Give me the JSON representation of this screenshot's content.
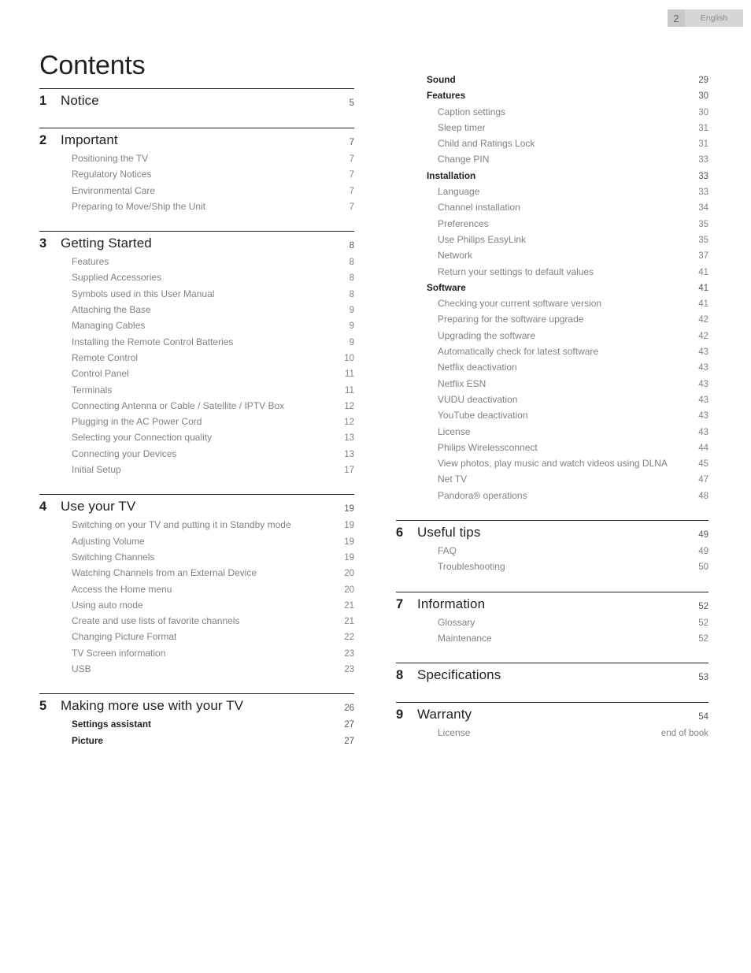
{
  "header": {
    "page_number": "2",
    "language": "English"
  },
  "title": "Contents",
  "columns": {
    "left": [
      {
        "number": "1",
        "title": "Notice",
        "page": "5",
        "entries": []
      },
      {
        "number": "2",
        "title": "Important",
        "page": "7",
        "entries": [
          {
            "level": 3,
            "label": "Positioning the TV",
            "page": "7"
          },
          {
            "level": 3,
            "label": "Regulatory Notices",
            "page": "7"
          },
          {
            "level": 3,
            "label": "Environmental Care",
            "page": "7"
          },
          {
            "level": 3,
            "label": "Preparing to Move/Ship the Unit",
            "page": "7"
          }
        ]
      },
      {
        "number": "3",
        "title": "Getting Started",
        "page": "8",
        "entries": [
          {
            "level": 3,
            "label": "Features",
            "page": "8"
          },
          {
            "level": 3,
            "label": "Supplied Accessories",
            "page": "8"
          },
          {
            "level": 3,
            "label": "Symbols used in this User Manual",
            "page": "8"
          },
          {
            "level": 3,
            "label": "Attaching the Base",
            "page": "9"
          },
          {
            "level": 3,
            "label": "Managing Cables",
            "page": "9"
          },
          {
            "level": 3,
            "label": "Installing the Remote Control Batteries",
            "page": "9"
          },
          {
            "level": 3,
            "label": "Remote Control",
            "page": "10"
          },
          {
            "level": 3,
            "label": "Control Panel",
            "page": "11"
          },
          {
            "level": 3,
            "label": "Terminals",
            "page": "11"
          },
          {
            "level": 3,
            "label": "Connecting Antenna or Cable / Satellite / IPTV Box",
            "page": "12"
          },
          {
            "level": 3,
            "label": "Plugging in the AC Power Cord",
            "page": "12"
          },
          {
            "level": 3,
            "label": "Selecting your Connection quality",
            "page": "13"
          },
          {
            "level": 3,
            "label": "Connecting your Devices",
            "page": "13"
          },
          {
            "level": 3,
            "label": "Initial Setup",
            "page": "17"
          }
        ]
      },
      {
        "number": "4",
        "title": "Use your TV",
        "page": "19",
        "entries": [
          {
            "level": 3,
            "label": "Switching on your TV and putting it in Standby mode",
            "page": "19"
          },
          {
            "level": 3,
            "label": "Adjusting Volume",
            "page": "19"
          },
          {
            "level": 3,
            "label": "Switching Channels",
            "page": "19"
          },
          {
            "level": 3,
            "label": "Watching Channels from an External Device",
            "page": "20"
          },
          {
            "level": 3,
            "label": "Access the Home menu",
            "page": "20"
          },
          {
            "level": 3,
            "label": "Using auto mode",
            "page": "21"
          },
          {
            "level": 3,
            "label": "Create and use lists of favorite channels",
            "page": "21"
          },
          {
            "level": 3,
            "label": "Changing Picture Format",
            "page": "22"
          },
          {
            "level": 3,
            "label": "TV Screen information",
            "page": "23"
          },
          {
            "level": 3,
            "label": "USB",
            "page": "23"
          }
        ]
      },
      {
        "number": "5",
        "title": "Making more use with your TV",
        "page": "26",
        "entries": [
          {
            "level": 2,
            "label": "Settings assistant",
            "page": "27"
          },
          {
            "level": 2,
            "label": "Picture",
            "page": "27"
          }
        ]
      }
    ],
    "right": [
      {
        "number": "",
        "title": "",
        "page": "",
        "entries": [
          {
            "level": 2,
            "label": "Sound",
            "page": "29"
          },
          {
            "level": 2,
            "label": "Features",
            "page": "30"
          },
          {
            "level": 3,
            "label": "Caption settings",
            "page": "30"
          },
          {
            "level": 3,
            "label": "Sleep timer",
            "page": "31"
          },
          {
            "level": 3,
            "label": "Child and Ratings Lock",
            "page": "31"
          },
          {
            "level": 3,
            "label": "Change PIN",
            "page": "33"
          },
          {
            "level": 2,
            "label": "Installation",
            "page": "33"
          },
          {
            "level": 3,
            "label": "Language",
            "page": "33"
          },
          {
            "level": 3,
            "label": "Channel installation",
            "page": "34"
          },
          {
            "level": 3,
            "label": "Preferences",
            "page": "35"
          },
          {
            "level": 3,
            "label": "Use Philips EasyLink",
            "page": "35"
          },
          {
            "level": 3,
            "label": "Network",
            "page": "37"
          },
          {
            "level": 3,
            "label": "Return your settings to default values",
            "page": "41"
          },
          {
            "level": 2,
            "label": "Software",
            "page": "41"
          },
          {
            "level": 3,
            "label": "Checking your current software version",
            "page": "41"
          },
          {
            "level": 3,
            "label": "Preparing for the software upgrade",
            "page": "42"
          },
          {
            "level": 3,
            "label": "Upgrading the software",
            "page": "42"
          },
          {
            "level": 3,
            "label": "Automatically check for latest software",
            "page": "43"
          },
          {
            "level": 3,
            "label": "Netflix deactivation",
            "page": "43"
          },
          {
            "level": 3,
            "label": "Netflix ESN",
            "page": "43"
          },
          {
            "level": 3,
            "label": "VUDU deactivation",
            "page": "43"
          },
          {
            "level": 3,
            "label": "YouTube deactivation",
            "page": "43"
          },
          {
            "level": 3,
            "label": "License",
            "page": "43"
          },
          {
            "level": 3,
            "label": "Philips Wirelessconnect",
            "page": "44"
          },
          {
            "level": 3,
            "label": "View photos, play music and watch videos using DLNA",
            "page": "45"
          },
          {
            "level": 3,
            "label": "Net TV",
            "page": "47"
          },
          {
            "level": 3,
            "label": "Pandora® operations",
            "page": "48"
          }
        ]
      },
      {
        "number": "6",
        "title": "Useful tips",
        "page": "49",
        "entries": [
          {
            "level": 3,
            "label": "FAQ",
            "page": "49"
          },
          {
            "level": 3,
            "label": "Troubleshooting",
            "page": "50"
          }
        ]
      },
      {
        "number": "7",
        "title": "Information",
        "page": "52",
        "entries": [
          {
            "level": 3,
            "label": "Glossary",
            "page": "52"
          },
          {
            "level": 3,
            "label": "Maintenance",
            "page": "52"
          }
        ]
      },
      {
        "number": "8",
        "title": "Specifications",
        "page": "53",
        "entries": []
      },
      {
        "number": "9",
        "title": "Warranty",
        "page": "54",
        "entries": [
          {
            "level": 3,
            "label": "License",
            "page": "end of book"
          }
        ]
      }
    ]
  }
}
